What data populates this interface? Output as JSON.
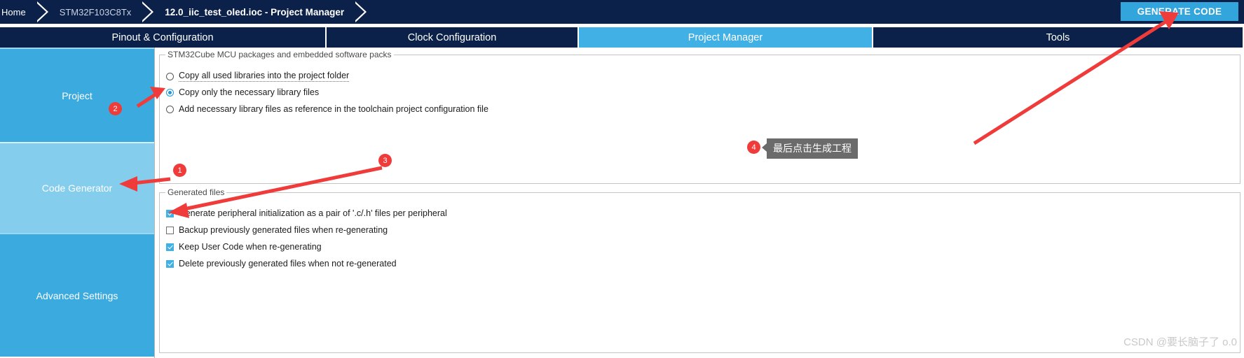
{
  "breadcrumb": {
    "items": [
      {
        "label": "Home",
        "state": "normal"
      },
      {
        "label": "STM32F103C8Tx",
        "state": "dim"
      },
      {
        "label": "12.0_iic_test_oled.ioc - Project Manager",
        "state": "active"
      }
    ]
  },
  "toolbar": {
    "generate_code_label": "GENERATE CODE",
    "accent_color": "#32a5dc",
    "bar_color": "#0b2149"
  },
  "tabs": [
    {
      "label": "Pinout & Configuration",
      "selected": false
    },
    {
      "label": "Clock Configuration",
      "selected": false
    },
    {
      "label": "Project Manager",
      "selected": true
    },
    {
      "label": "Tools",
      "selected": false
    }
  ],
  "sidebar": {
    "items": [
      {
        "label": "Project",
        "selected": false
      },
      {
        "label": "Code Generator",
        "selected": true
      },
      {
        "label": "Advanced Settings",
        "selected": false
      }
    ]
  },
  "main": {
    "packages_group": {
      "title": "STM32Cube MCU packages and embedded software packs",
      "options": [
        {
          "label": "Copy all used libraries into the project folder",
          "checked": false,
          "focused": true
        },
        {
          "label": "Copy only the necessary library files",
          "checked": true,
          "focused": false
        },
        {
          "label": "Add necessary library files as reference in the toolchain project configuration file",
          "checked": false,
          "focused": false
        }
      ]
    },
    "generated_files_group": {
      "title": "Generated files",
      "options": [
        {
          "label": "Generate peripheral initialization as a pair of '.c/.h' files per peripheral",
          "checked": true
        },
        {
          "label": "Backup previously generated files when re-generating",
          "checked": false
        },
        {
          "label": "Keep User Code when re-generating",
          "checked": true
        },
        {
          "label": "Delete previously generated files when not re-generated",
          "checked": true
        }
      ]
    }
  },
  "annotations": {
    "accent_color": "#f03b3b",
    "badges": [
      {
        "number": "1"
      },
      {
        "number": "2"
      },
      {
        "number": "3"
      },
      {
        "number": "4"
      }
    ],
    "tooltip": {
      "text": "最后点击生成工程"
    }
  },
  "watermark": {
    "text": "CSDN @要长脑子了 o.0"
  }
}
